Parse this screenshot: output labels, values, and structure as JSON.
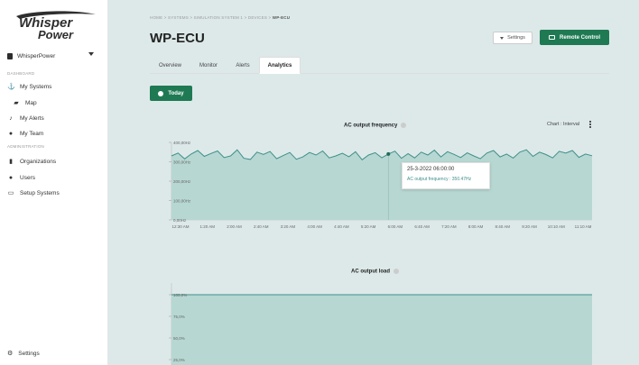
{
  "brand": {
    "logo_text": "Whisper Power"
  },
  "sidebar": {
    "org": "WhisperPower",
    "dashboard_label": "DASHBOARD",
    "admin_label": "ADMINISTRATION",
    "items": [
      {
        "label": "My Systems",
        "icon": "ship-icon"
      },
      {
        "label": "Map",
        "icon": "map-icon"
      },
      {
        "label": "My Alerts",
        "icon": "bell-icon"
      },
      {
        "label": "My Team",
        "icon": "team-icon"
      },
      {
        "label": "Organizations",
        "icon": "building-icon"
      },
      {
        "label": "Users",
        "icon": "users-icon"
      },
      {
        "label": "Setup Systems",
        "icon": "setup-icon"
      }
    ],
    "settings_label": "Settings"
  },
  "breadcrumb": {
    "path": "HOME > SYSTEMS > SIMULATION SYSTEM 1 > DEVICES > ",
    "current": "WP-ECU"
  },
  "page": {
    "title": "WP-ECU"
  },
  "header": {
    "settings_label": "Settings",
    "remote_label": "Remote Control"
  },
  "tabs": [
    {
      "label": "Overview"
    },
    {
      "label": "Monitor"
    },
    {
      "label": "Alerts"
    },
    {
      "label": "Analytics"
    }
  ],
  "active_tab": "Analytics",
  "today_label": "Today",
  "colors": {
    "accent": "#1f7a54",
    "area_fill": "#b7d7d2",
    "area_line": "#3f8f8a"
  },
  "chart_meta": {
    "chart_type_label": "Chart : Interval"
  },
  "tooltip": {
    "time": "25-3-2022 06:00:00",
    "value": "AC output frequency : 350.47Hz"
  },
  "chart_data": [
    {
      "type": "area",
      "title": "AC output frequency",
      "ylim": [
        0,
        400
      ],
      "y_ticks": [
        "400,00Hz",
        "300,00Hz",
        "200,00Hz",
        "100,00Hz",
        "0,00Hz"
      ],
      "x_ticks": [
        "12:30 AM",
        "1:20 AM",
        "2:00 AM",
        "2:40 AM",
        "3:20 AM",
        "4:00 AM",
        "4:40 AM",
        "5:20 AM",
        "6:00 AM",
        "6:40 AM",
        "7:20 AM",
        "8:00 AM",
        "8:40 AM",
        "9:20 AM",
        "10:10 AM",
        "11:10 AM"
      ],
      "values": [
        330,
        345,
        315,
        340,
        358,
        328,
        343,
        356,
        322,
        330,
        362,
        318,
        312,
        350,
        338,
        353,
        316,
        332,
        348,
        313,
        325,
        348,
        335,
        356,
        320,
        330,
        344,
        326,
        352,
        310,
        335,
        347,
        321,
        340,
        355,
        318,
        342,
        320,
        350,
        335,
        360,
        325,
        352,
        338,
        322,
        346,
        330,
        316,
        345,
        358,
        325,
        340,
        319,
        350,
        362,
        328,
        350,
        337,
        320,
        354,
        345,
        358,
        323,
        340,
        331
      ],
      "highlight_index": 33
    },
    {
      "type": "area",
      "title": "AC output load",
      "ylim": [
        0,
        100
      ],
      "y_ticks": [
        "100,0%",
        "75,0%",
        "50,0%",
        "25,0%"
      ],
      "values": [
        100,
        100,
        100,
        100,
        100,
        100,
        100,
        100,
        100,
        100
      ]
    }
  ]
}
